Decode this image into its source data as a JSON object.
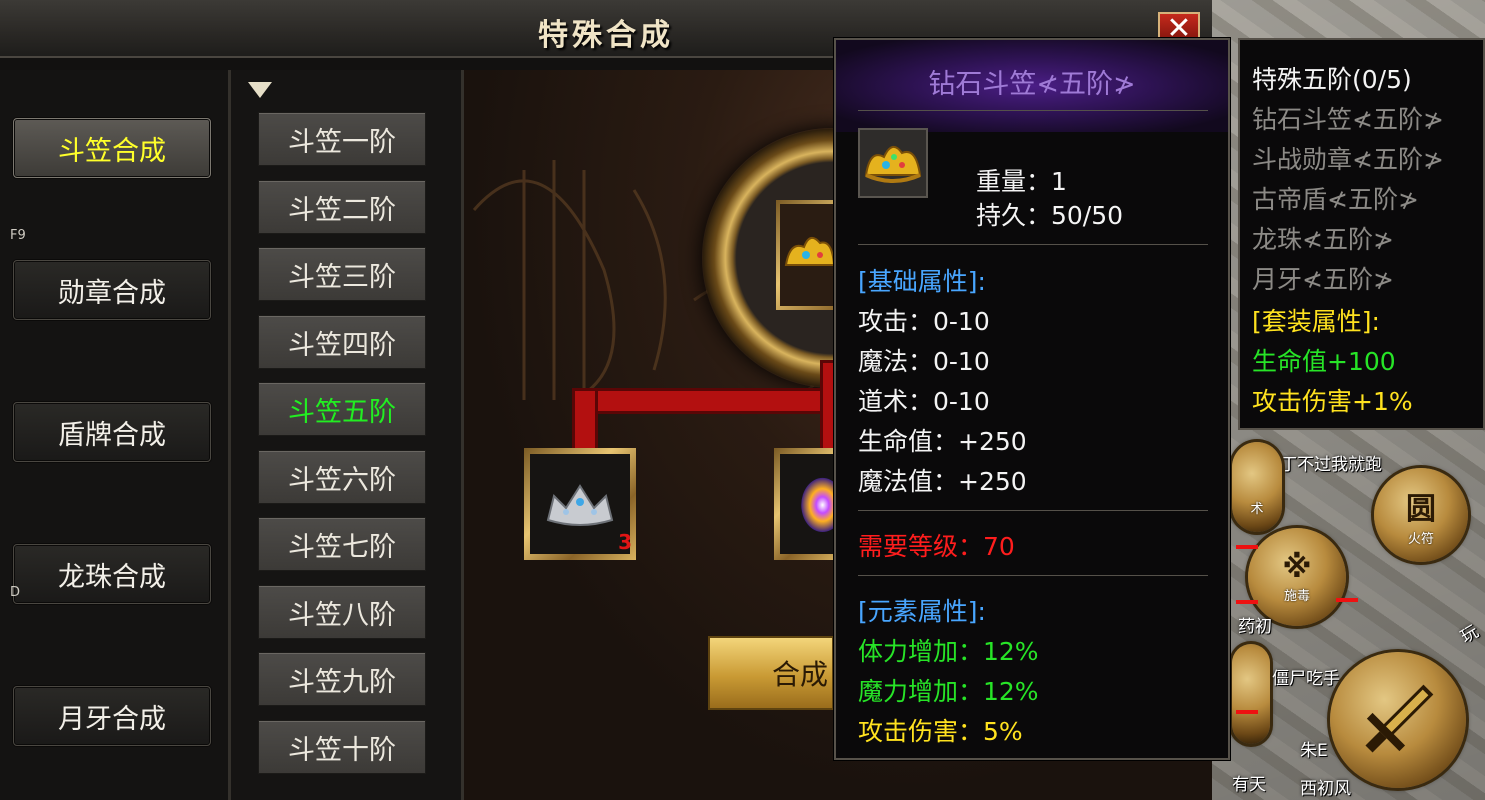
{
  "window": {
    "title": "特殊合成",
    "close_label": "✕"
  },
  "categories": [
    {
      "label": "斗笠合成",
      "active": true
    },
    {
      "label": "勋章合成",
      "active": false
    },
    {
      "label": "盾牌合成",
      "active": false
    },
    {
      "label": "龙珠合成",
      "active": false
    },
    {
      "label": "月牙合成",
      "active": false
    }
  ],
  "hotkeys": [
    "F9",
    "D"
  ],
  "tiers": [
    {
      "label": "斗笠一阶"
    },
    {
      "label": "斗笠二阶"
    },
    {
      "label": "斗笠三阶"
    },
    {
      "label": "斗笠四阶"
    },
    {
      "label": "斗笠五阶",
      "active": true
    },
    {
      "label": "斗笠六阶"
    },
    {
      "label": "斗笠七阶"
    },
    {
      "label": "斗笠八阶"
    },
    {
      "label": "斗笠九阶"
    },
    {
      "label": "斗笠十阶"
    }
  ],
  "material_slot": {
    "count": "3"
  },
  "synth_button": "合成",
  "tooltip": {
    "title": "钻石斗笠≮五阶≯",
    "weight": "重量：1",
    "durability": "持久：50/50",
    "base_header": "[基础属性]:",
    "base_stats": [
      "攻击：0-10",
      "魔法：0-10",
      "道术：0-10",
      "生命值：+250",
      "魔法值：+250"
    ],
    "required_level": "需要等级：70",
    "element_header": "[元素属性]:",
    "element_stats_green": [
      "体力增加：12%",
      "魔力增加：12%"
    ],
    "element_stat_yellow": "攻击伤害：5%"
  },
  "set_panel": {
    "title": "特殊五阶(0/5)",
    "items": [
      "钻石斗笠≮五阶≯",
      "斗战勋章≮五阶≯",
      "古帝盾≮五阶≯",
      "龙珠≮五阶≯",
      "月牙≮五阶≯"
    ],
    "bonus_header": "[套装属性]:",
    "bonus_green": "生命值+100",
    "bonus_yellow": "攻击伤害+1%"
  },
  "map": {
    "texts": [
      "丁不过我就跑",
      "术",
      "施毒",
      "火符",
      "药初",
      "僵尸吃手",
      "朱E",
      "有天",
      "西初风",
      "玩"
    ]
  },
  "colors": {
    "active_category": "#ffff2a",
    "active_tier": "#22ee22",
    "tooltip_title": "#9f7ad6",
    "attr_header": "#49a6ff",
    "required_level": "#ff1d1d",
    "green_stat": "#27e427",
    "yellow_stat": "#ffe21f"
  }
}
